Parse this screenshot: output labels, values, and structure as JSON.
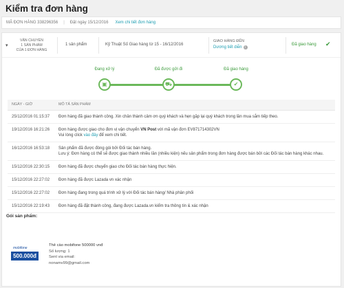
{
  "page": {
    "title": "Kiểm tra đơn hàng"
  },
  "order": {
    "number_label": "MÃ ĐƠN HÀNG 338296356",
    "date_label": "Đặt ngày 15/12/2016",
    "invoice_link": "Xem chi tiết đơn hàng"
  },
  "package": {
    "ship_line1": "VẬN CHUYỂN",
    "ship_line2": "1 SẢN PHẨM",
    "ship_line3": "CỦA 1 ĐƠN HÀNG",
    "quantity": "1 sản phẩm",
    "seller_eta": "Kỹ Thuật Số   Giao hàng từ 15 - 16/12/2016",
    "delivery_label": "GIAO HÀNG ĐẾN",
    "delivery_value": "Dương tiết diễn",
    "info_icon_glyph": "i",
    "status": "Đã giao hàng",
    "status_color": "#3a9a3a",
    "accent_color": "#1a9cb0"
  },
  "progress": {
    "steps": [
      {
        "label": "Đang xử lý",
        "icon": "box-icon",
        "glyph": "▣"
      },
      {
        "label": "Đã được gửi đi",
        "icon": "truck-icon",
        "glyph": "⛟"
      },
      {
        "label": "Đã giao hàng",
        "icon": "check-icon",
        "glyph": "✔"
      }
    ]
  },
  "history": {
    "columns": [
      "NGÀY - GIỜ",
      "MÔ TẢ SẢN PHẨM"
    ],
    "rows": [
      {
        "time": "25/12/2016 01:15:37",
        "desc": "Đơn hàng đã giao thành công. Xin chân thành cảm ơn quý khách và hẹn gặp lại quý khách trong lần mua sắm tiếp theo."
      },
      {
        "time": "19/12/2016 16:21:26",
        "desc_pre": "Đơn hàng được giao cho đơn vị vận chuyển",
        "carrier": "VN Post",
        "desc_post": "với mã vận đơn EV871714302VN",
        "desc2_pre": "Vui lòng click",
        "desc2_link": "vào đây",
        "desc2_post": "để xem chi tiết."
      },
      {
        "time": "16/12/2016 16:53:18",
        "desc": "Sản phẩm đã được đóng gói bởi Đối tác bán hàng.",
        "desc2": "Lưu ý: Đơn hàng có thể sẽ được giao thành nhiều lần (nhiều kiện) nếu sản phẩm trong đơn hàng được bán bởi các Đối tác bán hàng khác nhau."
      },
      {
        "time": "15/12/2016 22:30:15",
        "desc": "Đơn hàng đã được chuyển giao cho Đối tác bán hàng thực hiện."
      },
      {
        "time": "15/12/2016 22:27:02",
        "desc": "Đơn hàng đã được Lazada vn xác nhận"
      },
      {
        "time": "15/12/2016 22:27:02",
        "desc": "Đơn hàng đang trong quá trình xử lý với Đối tác bán hàng/ Nhà phân phối"
      },
      {
        "time": "15/12/2016 22:19:43",
        "desc": "Đơn hàng đã đặt thành công, đang được Lazada.vn kiểm tra thông tin & xác nhận"
      }
    ]
  },
  "package_products": {
    "title": "Gói sản phẩm:",
    "product": {
      "logo_text": "mobifone",
      "logo_amount": "500.000đ",
      "name": "Thẻ cào mobifone 500000 vnđ",
      "qty": "Số lượng: 1",
      "sent_via": "Sent via email:",
      "email": "nonamv99@gmail.com"
    }
  }
}
